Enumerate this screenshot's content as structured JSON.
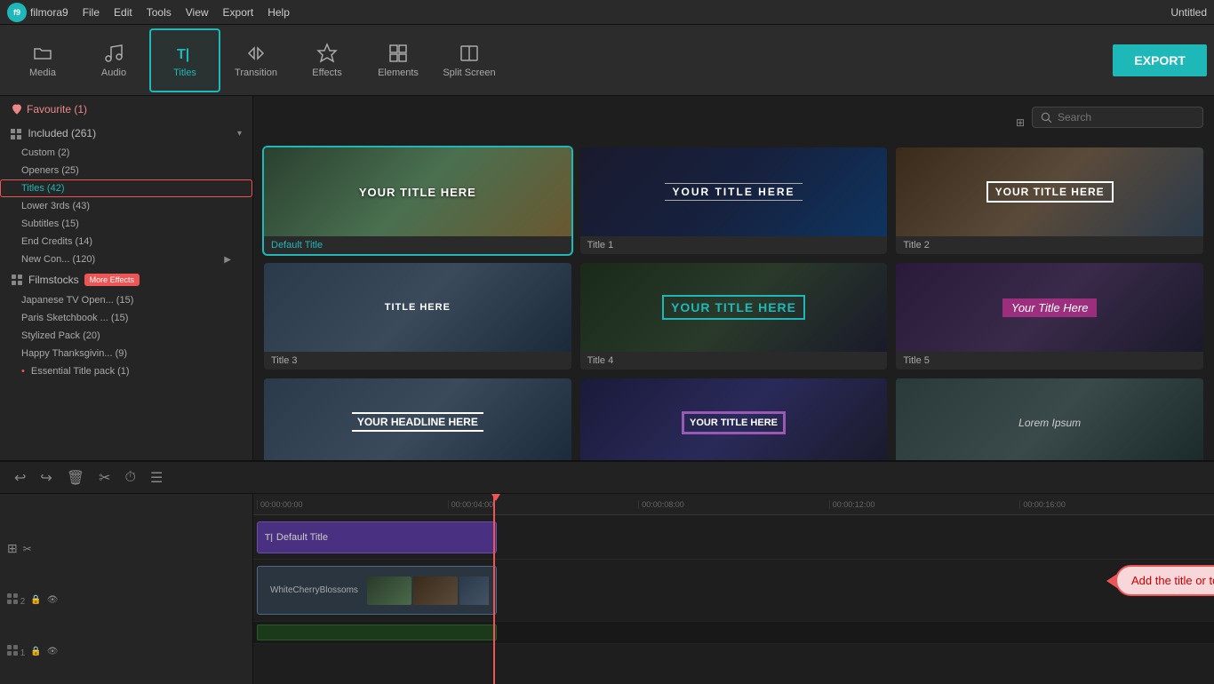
{
  "app": {
    "name": "filmora9",
    "window_title": "Untitled"
  },
  "menubar": {
    "items": [
      "File",
      "Edit",
      "Tools",
      "View",
      "Export",
      "Help"
    ]
  },
  "toolbar": {
    "buttons": [
      {
        "id": "media",
        "label": "Media",
        "icon": "folder"
      },
      {
        "id": "audio",
        "label": "Audio",
        "icon": "music"
      },
      {
        "id": "titles",
        "label": "Titles",
        "icon": "title",
        "active": true
      },
      {
        "id": "transition",
        "label": "Transition",
        "icon": "transition"
      },
      {
        "id": "effects",
        "label": "Effects",
        "icon": "effects"
      },
      {
        "id": "elements",
        "label": "Elements",
        "icon": "elements"
      },
      {
        "id": "split_screen",
        "label": "Split Screen",
        "icon": "split"
      }
    ],
    "export_label": "EXPORT"
  },
  "sidebar": {
    "favourite": "Favourite (1)",
    "included_label": "Included (261)",
    "categories": [
      {
        "label": "Custom (2)"
      },
      {
        "label": "Openers (25)"
      },
      {
        "label": "Titles (42)",
        "active": true
      },
      {
        "label": "Lower 3rds (43)"
      },
      {
        "label": "Subtitles (15)"
      },
      {
        "label": "End Credits (14)"
      },
      {
        "label": "New Con... (120)",
        "has_arrow": true
      }
    ],
    "filmstocks": {
      "label": "Filmstocks",
      "badge": "More Effects"
    },
    "filmstock_items": [
      {
        "label": "Japanese TV Open... (15)"
      },
      {
        "label": "Paris Sketchbook ... (15)"
      },
      {
        "label": "Stylized Pack (20)"
      },
      {
        "label": "Happy Thanksgivin... (9)"
      },
      {
        "label": "Essential Title pack (1)",
        "red_dot": true
      }
    ]
  },
  "search": {
    "placeholder": "Search"
  },
  "titles_grid": [
    {
      "id": "default_title",
      "label": "Default Title",
      "label_color": "teal",
      "text": "YOUR TITLE HERE",
      "style": "default"
    },
    {
      "id": "title_1",
      "label": "Title 1",
      "label_color": "gray",
      "text": "YOUR TITLE HERE",
      "style": "title1"
    },
    {
      "id": "title_2",
      "label": "Title 2",
      "label_color": "gray",
      "text": "YOUR TITLE HERE",
      "style": "title2"
    },
    {
      "id": "title_3",
      "label": "Title 3",
      "label_color": "gray",
      "text": "TITLE HERE",
      "style": "title3"
    },
    {
      "id": "title_4",
      "label": "Title 4",
      "label_color": "gray",
      "text": "YOUR TITLE HERE",
      "style": "title4"
    },
    {
      "id": "title_5",
      "label": "Title 5",
      "label_color": "gray",
      "text": "Your Title Here",
      "style": "title5"
    },
    {
      "id": "title_6",
      "label": "",
      "label_color": "gray",
      "text": "YOUR HEADLINE HERE",
      "style": "title6"
    },
    {
      "id": "title_7",
      "label": "",
      "label_color": "gray",
      "text": "YOUR TITLE HERE",
      "style": "title7"
    },
    {
      "id": "title_8",
      "label": "",
      "label_color": "gray",
      "text": "Lorem Ipsum",
      "style": "title8"
    }
  ],
  "timeline": {
    "toolbar_buttons": [
      "undo",
      "redo",
      "delete",
      "cut",
      "history",
      "settings"
    ],
    "ruler_marks": [
      "00:00:00:00",
      "00:00:04:00",
      "00:00:08:00",
      "00:00:12:00",
      "00:00:16:00"
    ],
    "tracks": [
      {
        "id": "track2",
        "number": "2",
        "clip_label": "Default Title",
        "clip_type": "title"
      },
      {
        "id": "track1",
        "number": "1",
        "clip_label": "WhiteCherryBlossoms",
        "clip_type": "video"
      }
    ]
  },
  "tooltip": {
    "text": "Add the title or text to the track above"
  }
}
